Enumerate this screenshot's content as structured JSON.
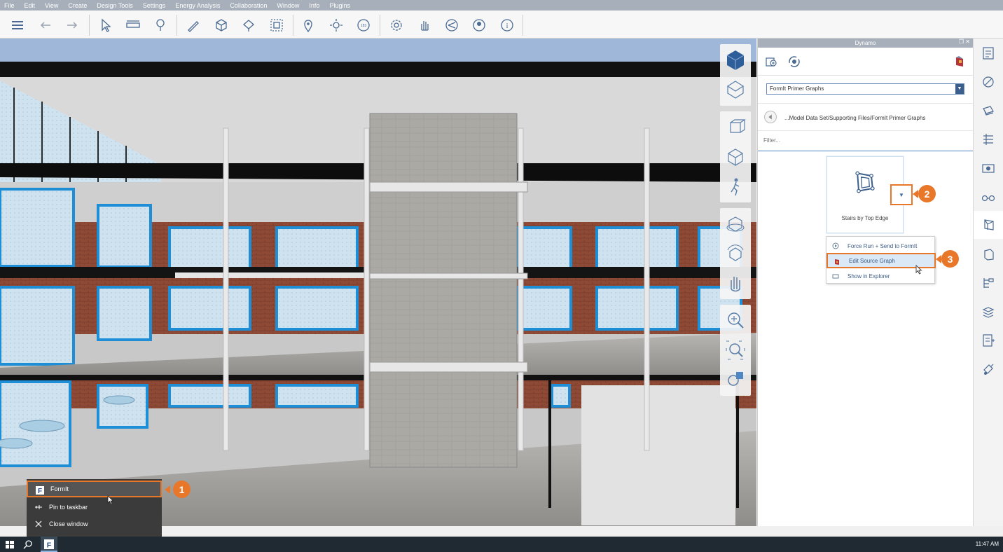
{
  "menubar": {
    "items": [
      "File",
      "Edit",
      "View",
      "Create",
      "Design Tools",
      "Settings",
      "Energy Analysis",
      "Collaboration",
      "Window",
      "Info",
      "Plugins"
    ]
  },
  "toolbar": {
    "icons": [
      "layers-icon",
      "undo-icon",
      "redo-icon",
      "select-icon",
      "measure-icon",
      "bulb-icon",
      "sketch-pencil-icon",
      "box-icon",
      "paint-icon",
      "group-icon",
      "location-icon",
      "sun-icon",
      "speed-icon",
      "settings-icon",
      "hand-icon",
      "share-icon",
      "user-icon",
      "info-icon"
    ]
  },
  "dynamo": {
    "title": "Dynamo",
    "window_controls": "❒ ✕",
    "directory_select": "FormIt Primer Graphs",
    "path_text": "...Model Data Set/Supporting Files/FormIt Primer Graphs",
    "filter_placeholder": "Filter...",
    "tile_label": "Stairs by Top Edge",
    "context_menu": [
      {
        "label": "Force Run + Send to FormIt",
        "icon": "run-icon"
      },
      {
        "label": "Edit Source Graph",
        "icon": "edit-graph-icon"
      },
      {
        "label": "Show in Explorer",
        "icon": "folder-icon"
      }
    ]
  },
  "jumplist": {
    "items": [
      {
        "label": "FormIt",
        "icon": "formit-app-icon"
      },
      {
        "label": "Pin to taskbar",
        "icon": "pin-icon"
      },
      {
        "label": "Close window",
        "icon": "close-icon"
      }
    ]
  },
  "badges": {
    "one": "1",
    "two": "2",
    "three": "3"
  },
  "taskbar": {
    "clock": "11:47 AM"
  },
  "colors": {
    "accent": "#e8772a",
    "menubar": "#a7afba",
    "dynamo_blue": "#3b5e8c",
    "taskbar": "#1f2a33"
  }
}
